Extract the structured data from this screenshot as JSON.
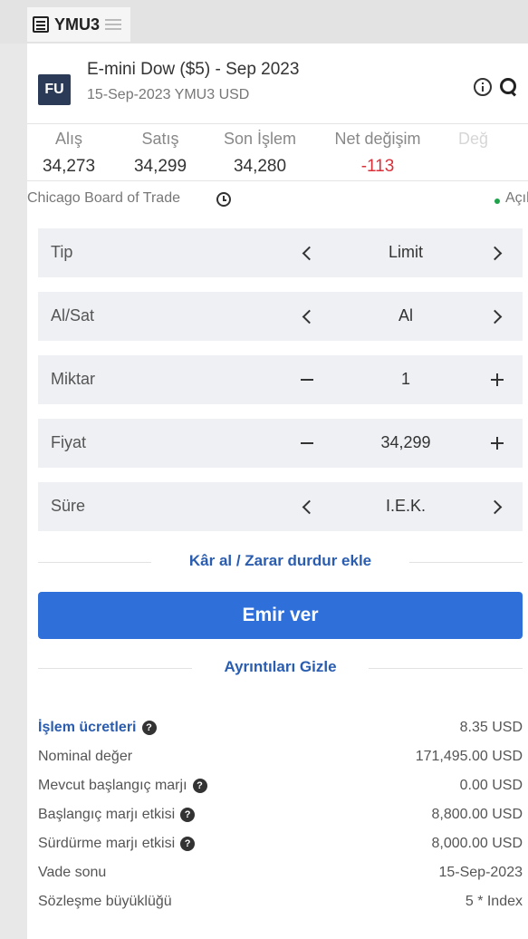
{
  "tab": {
    "title": "YMU3",
    "icon": "list-icon",
    "menu_icon": "menu-icon"
  },
  "instrument": {
    "badge": "FU",
    "name": "E-mini Dow ($5) - Sep 2023",
    "subtitle": "15-Sep-2023 YMU3 USD"
  },
  "quotes": [
    {
      "label": "Alış",
      "value": "34,273"
    },
    {
      "label": "Satış",
      "value": "34,299"
    },
    {
      "label": "Son İşlem",
      "value": "34,280"
    },
    {
      "label": "Net değişim",
      "value": "-113"
    },
    {
      "label": "Değ",
      "value": ""
    }
  ],
  "exchange": {
    "name": "Chicago Board of Trade",
    "status": "Açık",
    "status_color": "#1fa34a"
  },
  "order_fields": [
    {
      "label": "Tip",
      "value": "Limit",
      "control": "chevrons"
    },
    {
      "label": "Al/Sat",
      "value": "Al",
      "control": "chevrons"
    },
    {
      "label": "Miktar",
      "value": "1",
      "control": "stepper"
    },
    {
      "label": "Fiyat",
      "value": "34,299",
      "control": "stepper"
    },
    {
      "label": "Süre",
      "value": "I.E.K.",
      "control": "chevrons"
    }
  ],
  "tp_sl_link": "Kâr al / Zarar durdur ekle",
  "submit_label": "Emir ver",
  "details_toggle": "Ayrıntıları Gizle",
  "details": [
    {
      "label": "İşlem ücretleri",
      "value": "8.35 USD",
      "help": true,
      "link": true
    },
    {
      "label": "Nominal değer",
      "value": "171,495.00 USD",
      "help": false,
      "link": false
    },
    {
      "label": "Mevcut başlangıç marjı",
      "value": "0.00 USD",
      "help": true,
      "link": false
    },
    {
      "label": "Başlangıç marjı etkisi",
      "value": "8,800.00 USD",
      "help": true,
      "link": false
    },
    {
      "label": "Sürdürme marjı etkisi",
      "value": "8,000.00 USD",
      "help": true,
      "link": false
    },
    {
      "label": "Vade sonu",
      "value": "15-Sep-2023",
      "help": false,
      "link": false
    },
    {
      "label": "Sözleşme büyüklüğü",
      "value": "5 * Index",
      "help": false,
      "link": false
    }
  ],
  "colors": {
    "accent": "#2f6fd9",
    "link": "#2a5db0",
    "negative": "#d9313a",
    "badge_bg": "#2b3b57"
  }
}
